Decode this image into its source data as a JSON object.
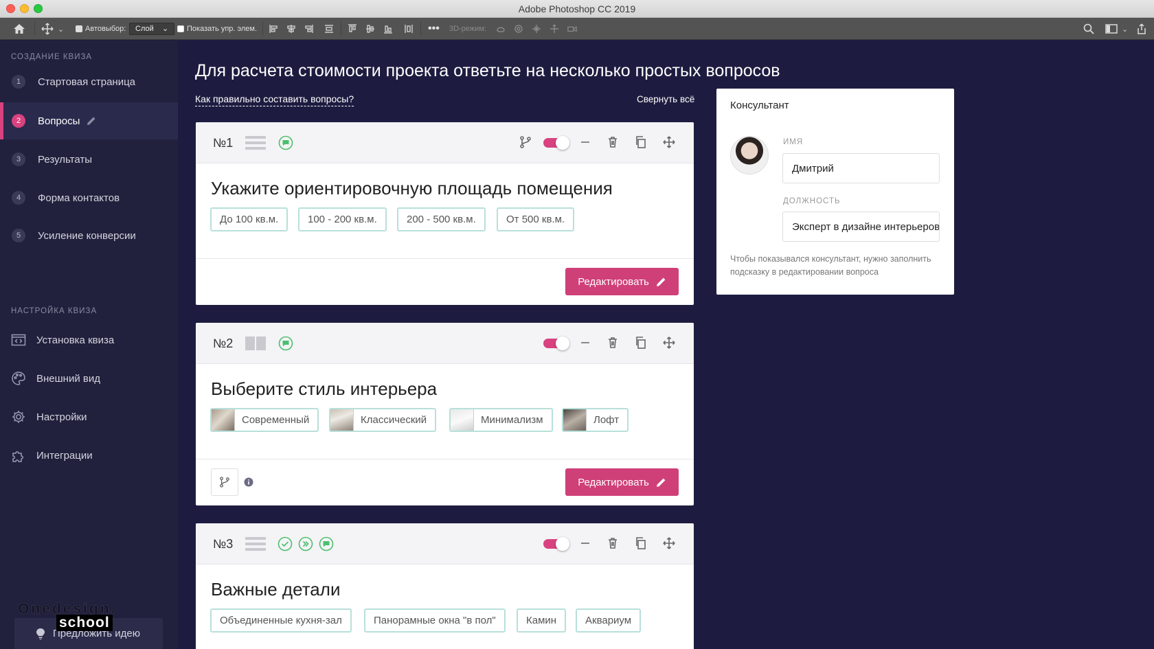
{
  "window": {
    "title": "Adobe Photoshop CC 2019"
  },
  "ps_options": {
    "autoselect_label": "Автовыбор:",
    "autoselect_value": "Слой",
    "show_controls_label": "Показать упр. элем.",
    "mode_3d_label": "3D-режим:"
  },
  "sidebar": {
    "section_create": "Создание квиза",
    "steps": [
      {
        "num": "1",
        "label": "Стартовая страница"
      },
      {
        "num": "2",
        "label": "Вопросы"
      },
      {
        "num": "3",
        "label": "Результаты"
      },
      {
        "num": "4",
        "label": "Форма контактов"
      },
      {
        "num": "5",
        "label": "Усиление конверсии"
      }
    ],
    "section_settings": "Настройка квиза",
    "settings": [
      {
        "label": "Установка квиза",
        "icon": "code-window-icon"
      },
      {
        "label": "Внешний вид",
        "icon": "palette-icon"
      },
      {
        "label": "Настройки",
        "icon": "gear-icon"
      },
      {
        "label": "Интеграции",
        "icon": "puzzle-icon"
      }
    ],
    "suggest_label": "Предложить идею",
    "watermark_top": "Onedesign.",
    "watermark_bottom": "school"
  },
  "main": {
    "title": "Для расчета стоимости проекта ответьте на несколько простых вопросов",
    "howto_link": "Как правильно составить вопросы?",
    "collapse_all": "Свернуть всё",
    "edit_label": "Редактировать",
    "questions": [
      {
        "num": "№1",
        "title": "Укажите ориентировочную площадь помещения",
        "answers": [
          "До 100 кв.м.",
          "100 - 200 кв.м.",
          "200 - 500 кв.м.",
          "От 500 кв.м."
        ]
      },
      {
        "num": "№2",
        "title": "Выберите стиль интерьера",
        "answers": [
          "Современный",
          "Классический",
          "Минимализм",
          "Лофт"
        ]
      },
      {
        "num": "№3",
        "title": "Важные детали",
        "answers": [
          "Объединенные кухня-зал",
          "Панорамные окна \"в пол\"",
          "Камин",
          "Аквариум"
        ]
      }
    ]
  },
  "consultant": {
    "title": "Консультант",
    "name_label": "Имя",
    "name_value": "Дмитрий",
    "position_label": "Должность",
    "position_value": "Эксперт в дизайне интерьеров",
    "hint": "Чтобы показывался консультант, нужно заполнить подсказку в редактировании вопроса"
  },
  "colors": {
    "accent": "#cf3f78",
    "sidebar_bg": "#21213d",
    "page_bg": "#1d1c40",
    "answer_border": "#b8e0da",
    "green_icon": "#4cbf6e"
  }
}
